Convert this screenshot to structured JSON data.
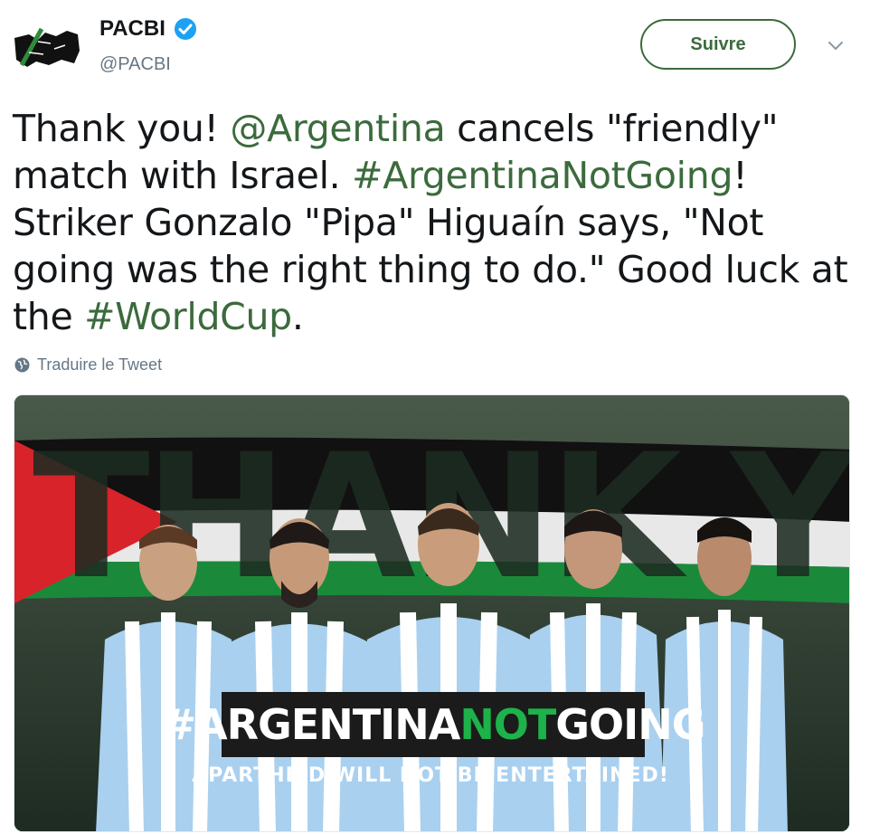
{
  "account": {
    "name": "PACBI",
    "handle": "@PACBI",
    "verified": true
  },
  "actions": {
    "follow_label": "Suivre",
    "menu_icon": "chevron-down-icon"
  },
  "tweet": {
    "lines": [
      [
        {
          "t": "Thank you! "
        },
        {
          "t": "@Argentina",
          "link": true
        },
        {
          "t": " cancels \"friendly\""
        }
      ],
      [
        {
          "t": "match with Israel. "
        },
        {
          "t": "#ArgentinaNotGoing",
          "link": true
        },
        {
          "t": "!"
        }
      ],
      [
        {
          "t": "Striker Gonzalo \"Pipa\" Higuaín says, \"Not"
        }
      ],
      [
        {
          "t": "going was the right thing to do.\" Good luck at"
        }
      ],
      [
        {
          "t": "the "
        },
        {
          "t": "#WorldCup",
          "link": true
        },
        {
          "t": "."
        }
      ]
    ]
  },
  "translate_label": "Traduire le Tweet",
  "media": {
    "headline": "THANK YOU!",
    "banner_part1": "#ARGENTINA",
    "banner_part2": "NOT",
    "banner_part3": "GOING",
    "subline": "APARTHEID WILL NOT BE ENTERTAINED!"
  },
  "colors": {
    "accent": "#3b6b3c",
    "verified": "#1da1f2",
    "secondary_text": "#657786"
  }
}
